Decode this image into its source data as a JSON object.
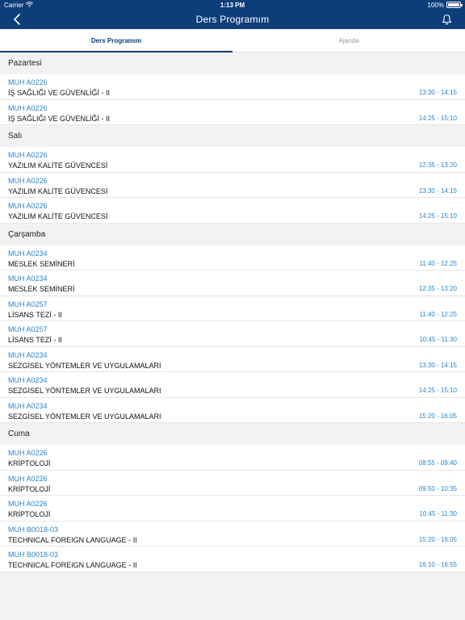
{
  "status": {
    "carrier": "Carrier",
    "time": "1:13 PM",
    "battery": "100%"
  },
  "nav": {
    "title": "Ders Programım"
  },
  "tabs": [
    {
      "label": "Ders Programım",
      "active": true
    },
    {
      "label": "Ajanda",
      "active": false
    }
  ],
  "days": [
    {
      "name": "Pazartesi",
      "items": [
        {
          "code": "MUH A0226",
          "name": "İŞ SAĞLIĞI VE GÜVENLİĞİ - II",
          "time": "13:30 - 14:15"
        },
        {
          "code": "MUH A0226",
          "name": "İŞ SAĞLIĞI VE GÜVENLİĞİ - II",
          "time": "14:25 - 15:10"
        }
      ]
    },
    {
      "name": "Salı",
      "items": [
        {
          "code": "MUH A0226",
          "name": "YAZILIM KALİTE GÜVENCESİ",
          "time": "12:35 - 13:20"
        },
        {
          "code": "MUH A0226",
          "name": "YAZILIM KALİTE GÜVENCESİ",
          "time": "13:30 - 14:15"
        },
        {
          "code": "MUH A0226",
          "name": "YAZILIM KALİTE GÜVENCESİ",
          "time": "14:25 - 15:10"
        }
      ]
    },
    {
      "name": "Çarşamba",
      "items": [
        {
          "code": "MUH A0234",
          "name": "MESLEK SEMİNERİ",
          "time": "11:40 - 12:25"
        },
        {
          "code": "MUH A0234",
          "name": "MESLEK SEMİNERİ",
          "time": "12:35 - 13:20"
        },
        {
          "code": "MUH A0257",
          "name": "LİSANS TEZİ - II",
          "time": "11:40 - 12:25"
        },
        {
          "code": "MUH A0257",
          "name": "LİSANS TEZİ - II",
          "time": "10:45 - 11:30"
        },
        {
          "code": "MUH A0234",
          "name": "SEZGİSEL YÖNTEMLER VE UYGULAMALARI",
          "time": "13:30 - 14:15"
        },
        {
          "code": "MUH A0234",
          "name": "SEZGİSEL YÖNTEMLER VE UYGULAMALARI",
          "time": "14:25 - 15:10"
        },
        {
          "code": "MUH A0234",
          "name": "SEZGİSEL YÖNTEMLER VE UYGULAMALARI",
          "time": "15:20 - 16:05"
        }
      ]
    },
    {
      "name": "Cuma",
      "items": [
        {
          "code": "MUH A0226",
          "name": "KRİPTOLOJİ",
          "time": "08:55 - 09:40"
        },
        {
          "code": "MUH A0226",
          "name": "KRİPTOLOJİ",
          "time": "09:50 - 10:35"
        },
        {
          "code": "MUH A0226",
          "name": "KRİPTOLOJİ",
          "time": "10:45 - 11:30"
        },
        {
          "code": "MUH B0018-03",
          "name": "TECHNICAL FOREIGN LANGUAGE - II",
          "time": "15:20 - 16:05"
        },
        {
          "code": "MUH B0018-03",
          "name": "TECHNICAL FOREIGN LANGUAGE - II",
          "time": "16:10 - 16:55"
        }
      ]
    }
  ]
}
